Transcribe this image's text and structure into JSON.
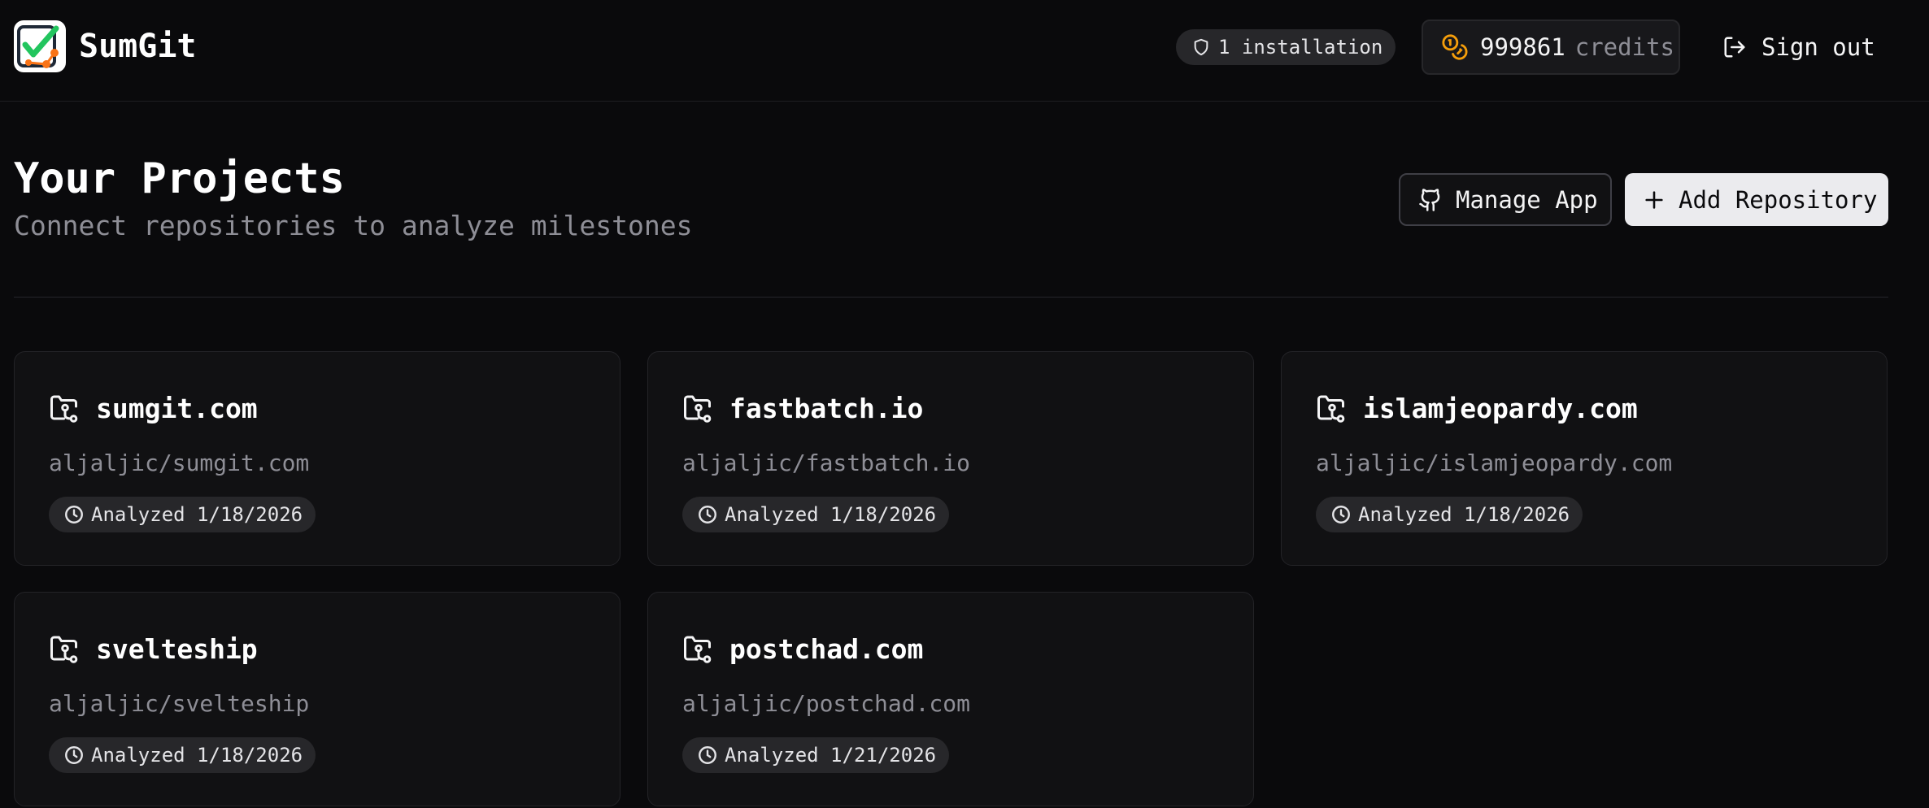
{
  "header": {
    "brand": "SumGit",
    "installations": "1 installation",
    "credits_value": "999861",
    "credits_unit": "credits",
    "sign_out": "Sign out"
  },
  "main": {
    "title": "Your Projects",
    "subtitle": "Connect repositories to analyze milestones",
    "manage_app": "Manage App",
    "add_repository": "Add Repository"
  },
  "projects": [
    {
      "name": "sumgit.com",
      "repo": "aljaljic/sumgit.com",
      "analyzed": "Analyzed 1/18/2026"
    },
    {
      "name": "fastbatch.io",
      "repo": "aljaljic/fastbatch.io",
      "analyzed": "Analyzed 1/18/2026"
    },
    {
      "name": "islamjeopardy.com",
      "repo": "aljaljic/islamjeopardy.com",
      "analyzed": "Analyzed 1/18/2026"
    },
    {
      "name": "svelteship",
      "repo": "aljaljic/svelteship",
      "analyzed": "Analyzed 1/18/2026"
    },
    {
      "name": "postchad.com",
      "repo": "aljaljic/postchad.com",
      "analyzed": "Analyzed 1/21/2026"
    }
  ],
  "colors": {
    "background": "#0a0a0c",
    "card": "#111113",
    "accent_coin": "#f59e0b",
    "logo_green": "#22c55e",
    "logo_orange": "#f97316"
  },
  "icons": [
    "app-logo",
    "shield-icon",
    "coins-icon",
    "sign-out-icon",
    "github-icon",
    "plus-icon",
    "folder-git-icon",
    "clock-icon"
  ]
}
